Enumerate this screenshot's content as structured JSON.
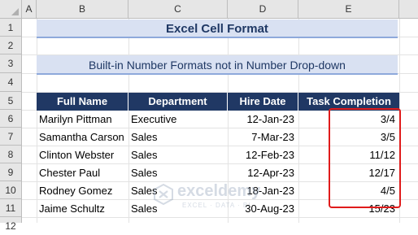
{
  "columns": [
    "A",
    "B",
    "C",
    "D",
    "E"
  ],
  "rows": [
    "1",
    "2",
    "3",
    "4",
    "5",
    "6",
    "7",
    "8",
    "9",
    "10",
    "11",
    "12"
  ],
  "title": "Excel Cell Format",
  "subtitle": "Built-in Number Formats not in Number Drop-down",
  "table": {
    "headers": [
      "Full Name",
      "Department",
      "Hire Date",
      "Task Completion"
    ],
    "rows": [
      [
        "Marilyn Pittman",
        "Executive",
        "12-Jan-23",
        "3/4"
      ],
      [
        "Samantha Carson",
        "Sales",
        "7-Mar-23",
        "3/5"
      ],
      [
        "Clinton Webster",
        "Sales",
        "12-Feb-23",
        "11/12"
      ],
      [
        "Chester Paul",
        "Sales",
        "12-Apr-23",
        "12/17"
      ],
      [
        "Rodney Gomez",
        "Sales",
        "18-Jan-23",
        "4/5"
      ],
      [
        "Jaime Schultz",
        "Sales",
        "30-Aug-23",
        "15/23"
      ]
    ]
  },
  "watermark": {
    "name": "exceldemy",
    "tagline": "EXCEL · DATA · BI"
  },
  "colors": {
    "header_bg": "#203864",
    "banner_bg": "#d9e1f2",
    "highlight_border": "#e01b1b"
  }
}
